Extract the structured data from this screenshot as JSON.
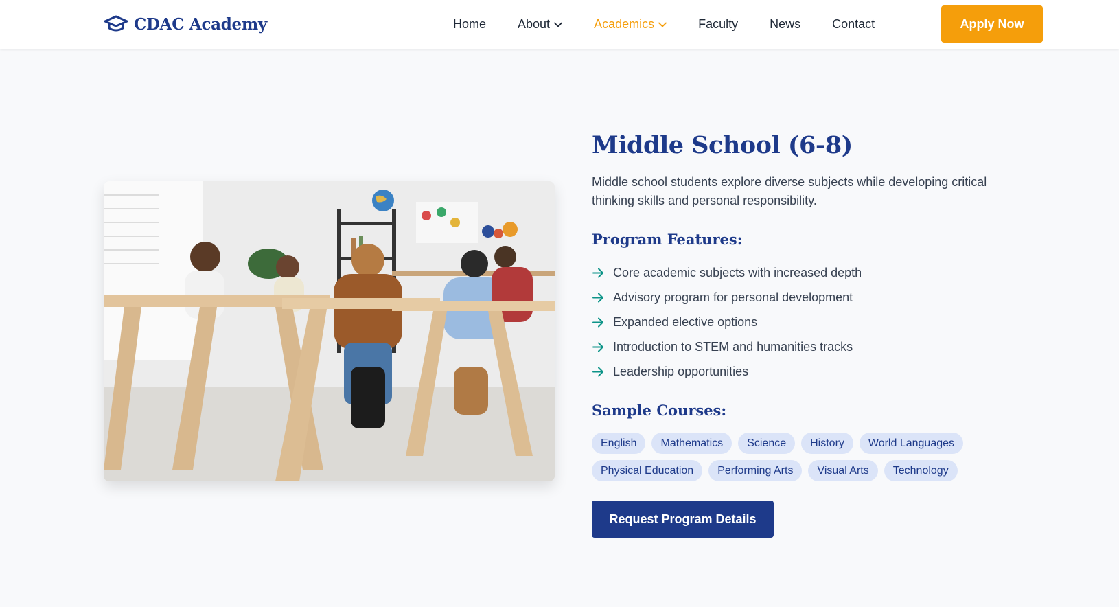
{
  "nav": {
    "brand": "CDAC Academy",
    "brand_icon": "graduation-cap-icon",
    "links": [
      {
        "label": "Home",
        "dropdown": false,
        "active": false
      },
      {
        "label": "About",
        "dropdown": true,
        "active": false
      },
      {
        "label": "Academics",
        "dropdown": true,
        "active": true
      },
      {
        "label": "Faculty",
        "dropdown": false,
        "active": false
      },
      {
        "label": "News",
        "dropdown": false,
        "active": false
      },
      {
        "label": "Contact",
        "dropdown": false,
        "active": false
      }
    ],
    "cta": "Apply Now"
  },
  "program": {
    "title": "Middle School (6-8)",
    "description": "Middle school students explore diverse subjects while developing critical thinking skills and personal responsibility.",
    "features_heading": "Program Features:",
    "features": [
      "Core academic subjects with increased depth",
      "Advisory program for personal development",
      "Expanded elective options",
      "Introduction to STEM and humanities tracks",
      "Leadership opportunities"
    ],
    "courses_heading": "Sample Courses:",
    "courses": [
      "English",
      "Mathematics",
      "Science",
      "History",
      "World Languages",
      "Physical Education",
      "Performing Arts",
      "Visual Arts",
      "Technology"
    ],
    "cta": "Request Program Details"
  },
  "colors": {
    "primary": "#1e3a8a",
    "accent": "#f59e0b",
    "chip_bg": "#dbe4f8",
    "arrow": "#0d9488",
    "background": "#f8f9fb"
  }
}
